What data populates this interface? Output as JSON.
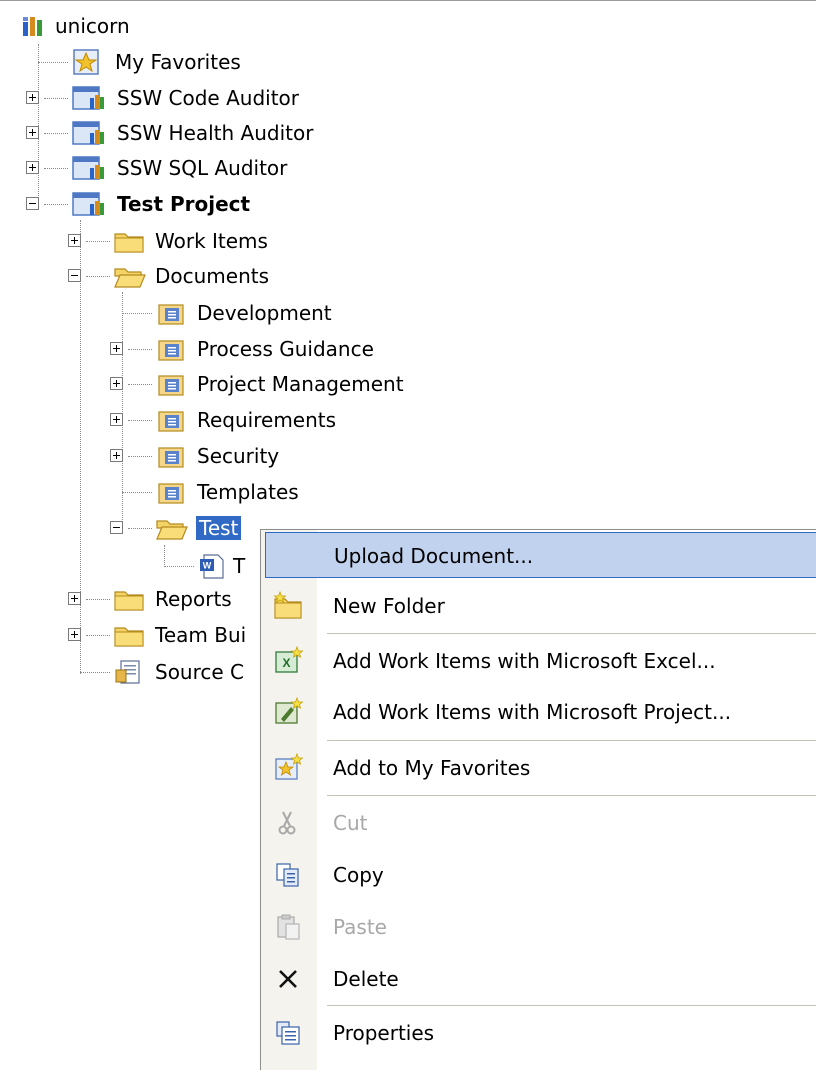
{
  "tree": {
    "root": {
      "label": "unicorn",
      "icon": "server-icon"
    },
    "items": [
      {
        "key": "favorites",
        "label": "My Favorites",
        "icon": "favorites-star-icon"
      },
      {
        "key": "code_auditor",
        "label": "SSW Code Auditor",
        "icon": "team-project-icon",
        "expander": "plus"
      },
      {
        "key": "health_auditor",
        "label": "SSW Health Auditor",
        "icon": "team-project-icon",
        "expander": "plus"
      },
      {
        "key": "sql_auditor",
        "label": "SSW SQL Auditor",
        "icon": "team-project-icon",
        "expander": "plus"
      },
      {
        "key": "test_project",
        "label": "Test Project",
        "icon": "team-project-icon",
        "expander": "minus",
        "bold": true
      },
      {
        "key": "work_items",
        "label": "Work Items",
        "icon": "folder-icon",
        "expander": "plus"
      },
      {
        "key": "documents",
        "label": "Documents",
        "icon": "folder-open-icon",
        "expander": "minus"
      },
      {
        "key": "development",
        "label": "Development",
        "icon": "document-library-icon"
      },
      {
        "key": "process_guidance",
        "label": "Process Guidance",
        "icon": "document-library-icon",
        "expander": "plus"
      },
      {
        "key": "project_management",
        "label": "Project Management",
        "icon": "document-library-icon",
        "expander": "plus"
      },
      {
        "key": "requirements",
        "label": "Requirements",
        "icon": "document-library-icon",
        "expander": "plus"
      },
      {
        "key": "security",
        "label": "Security",
        "icon": "document-library-icon",
        "expander": "plus"
      },
      {
        "key": "templates",
        "label": "Templates",
        "icon": "document-library-icon"
      },
      {
        "key": "test",
        "label": "Test",
        "icon": "folder-open-icon",
        "expander": "minus",
        "selected": true
      },
      {
        "key": "test_doc",
        "label": "T",
        "icon": "word-document-icon"
      },
      {
        "key": "reports",
        "label": "Reports",
        "icon": "folder-icon",
        "expander": "plus"
      },
      {
        "key": "team_build",
        "label": "Team Bui",
        "icon": "folder-icon",
        "expander": "plus"
      },
      {
        "key": "source_control",
        "label": "Source C",
        "icon": "source-control-icon"
      }
    ]
  },
  "context_menu": {
    "items": [
      {
        "key": "upload",
        "label": "Upload Document...",
        "icon": "",
        "highlight": true
      },
      {
        "key": "new_folder",
        "label": "New Folder",
        "icon": "new-folder-icon"
      },
      {
        "key": "excel",
        "label": "Add Work Items with Microsoft Excel...",
        "icon": "excel-add-icon"
      },
      {
        "key": "project",
        "label": "Add Work Items with Microsoft Project...",
        "icon": "project-add-icon"
      },
      {
        "key": "favorites",
        "label": "Add to My Favorites",
        "icon": "add-favorite-icon"
      },
      {
        "key": "cut",
        "label": "Cut",
        "icon": "cut-icon",
        "disabled": true
      },
      {
        "key": "copy",
        "label": "Copy",
        "icon": "copy-icon"
      },
      {
        "key": "paste",
        "label": "Paste",
        "icon": "paste-icon",
        "disabled": true
      },
      {
        "key": "delete",
        "label": "Delete",
        "icon": "delete-icon"
      },
      {
        "key": "properties",
        "label": "Properties",
        "icon": "properties-icon"
      }
    ]
  },
  "colors": {
    "selection": "#316ac5",
    "menu_highlight": "#c1d2ee",
    "menu_gutter": "#f4f3ee",
    "disabled_text": "#a8a8a8"
  }
}
